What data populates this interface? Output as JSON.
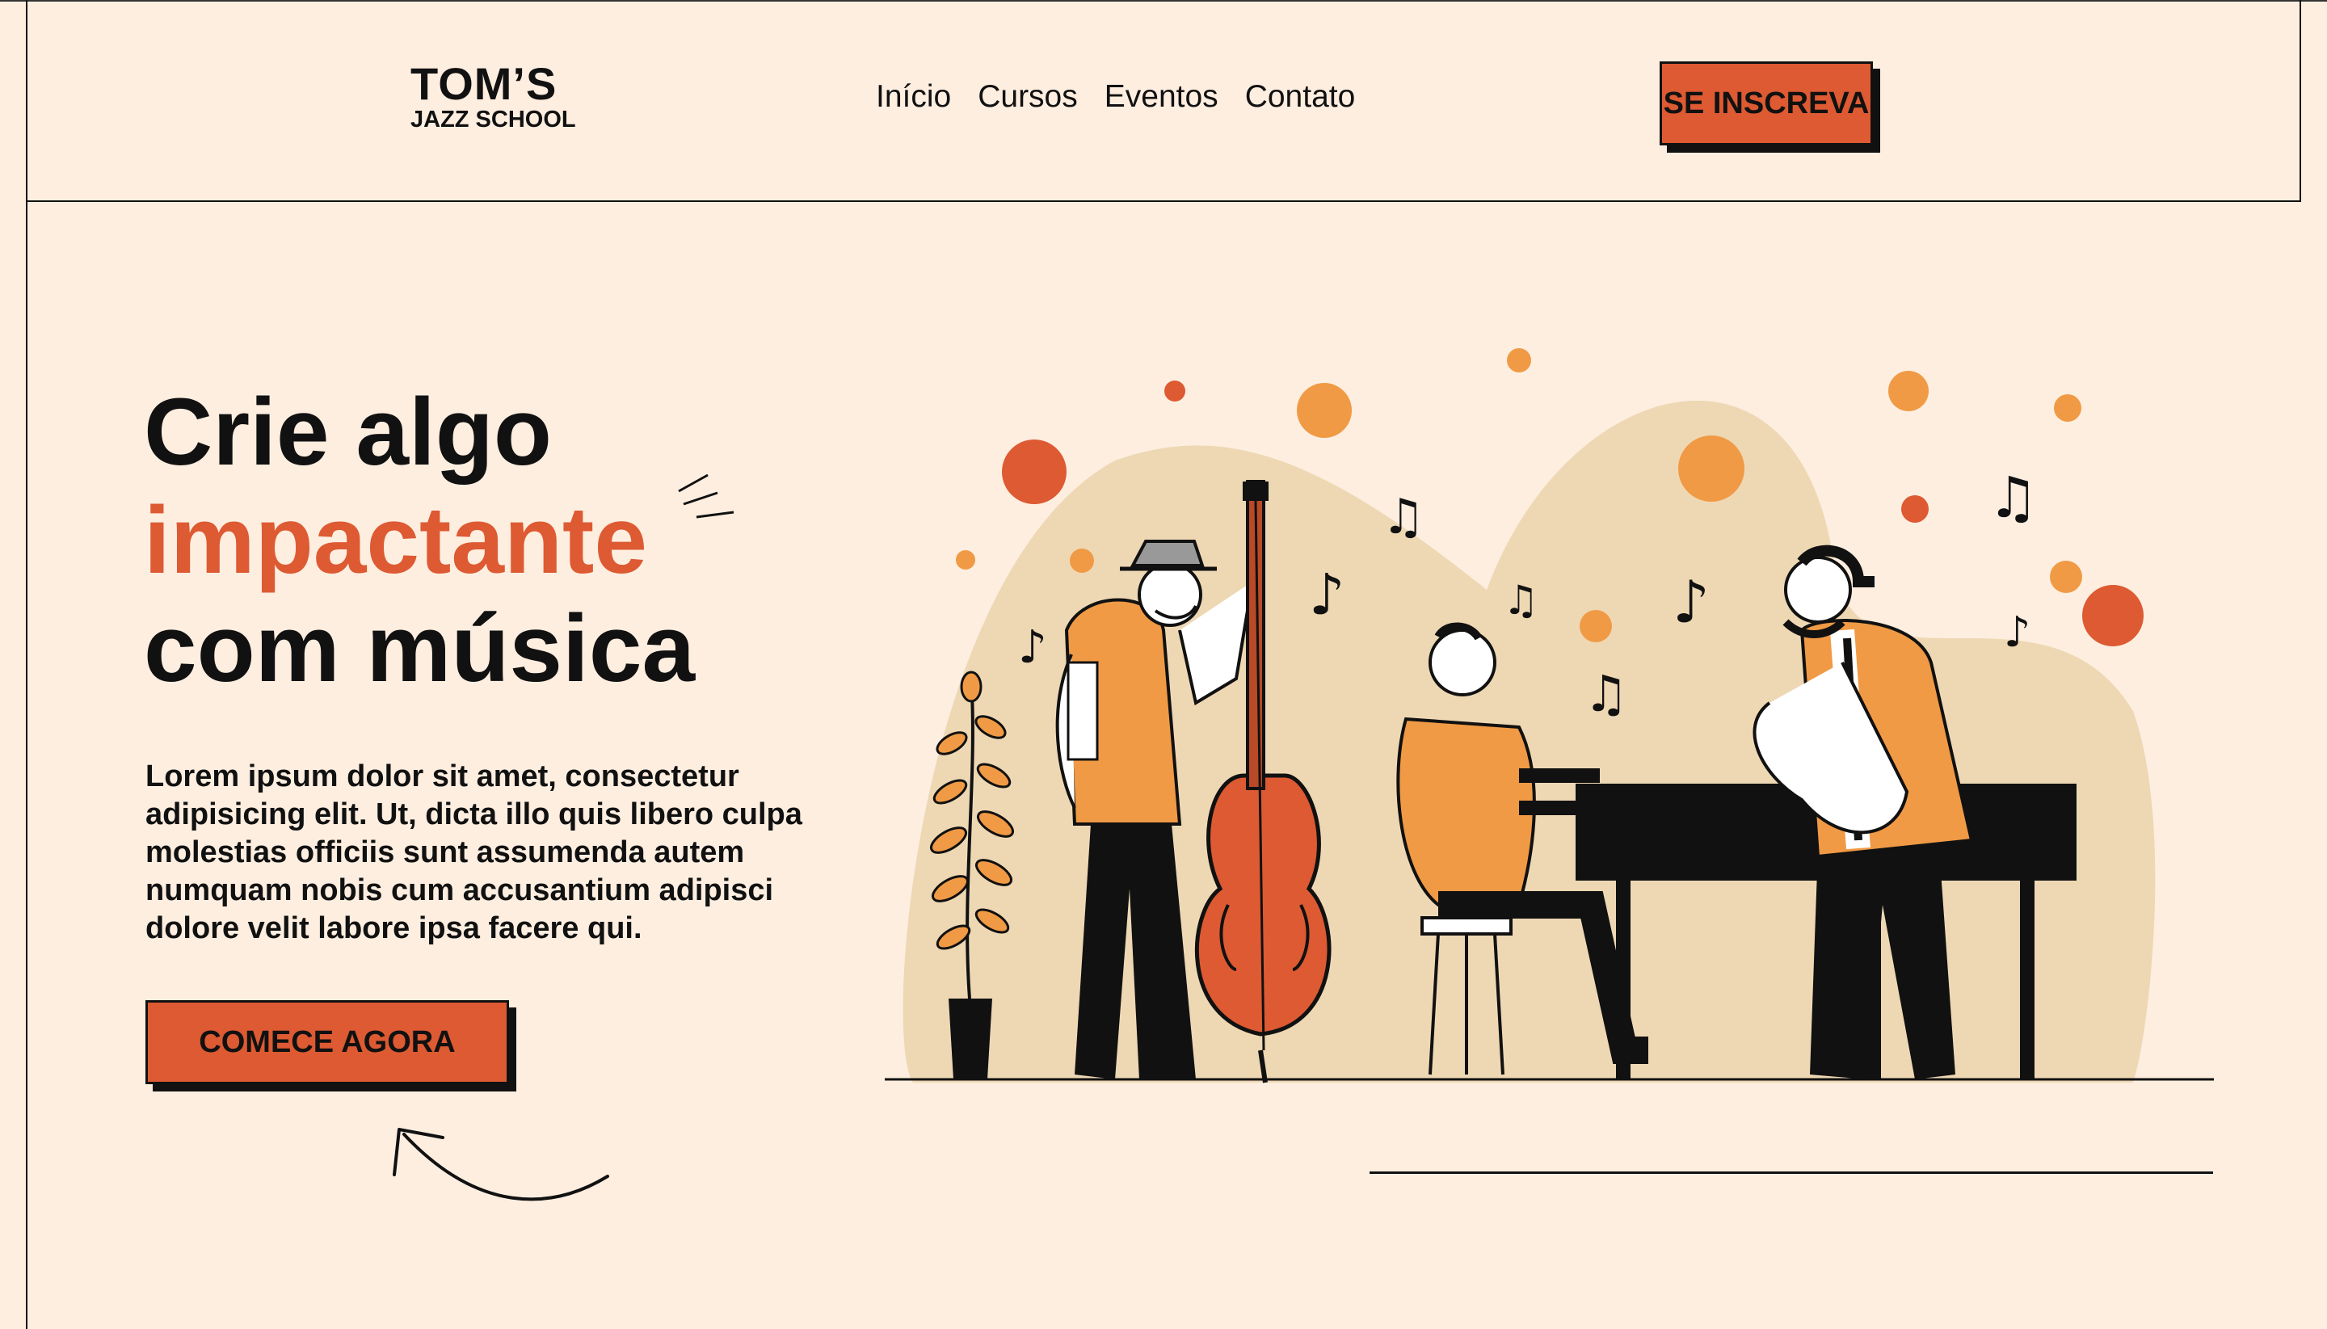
{
  "brand": {
    "name": "TOM’S",
    "subtitle": "JAZZ SCHOOL"
  },
  "nav": {
    "items": [
      "Início",
      "Cursos",
      "Eventos",
      "Contato"
    ]
  },
  "header_cta": "SE INSCREVA",
  "hero": {
    "line1": "Crie algo",
    "line2": "impactante",
    "line3": "com música",
    "body": "Lorem ipsum dolor sit amet, consectetur adipisicing elit. Ut, dicta illo quis libero culpa molestias officiis sunt assumenda autem numquam nobis cum accusantium adipisci dolore velit labore ipsa facere qui.",
    "cta": "COMECE AGORA"
  },
  "colors": {
    "background": "#fdeee0",
    "accent": "#dd5a32",
    "orange": "#f09a45",
    "blob": "#eed8b4",
    "ink": "#111111"
  },
  "icons": [
    "curved-arrow-icon",
    "sparkle-lines-icon",
    "music-note-icon"
  ]
}
